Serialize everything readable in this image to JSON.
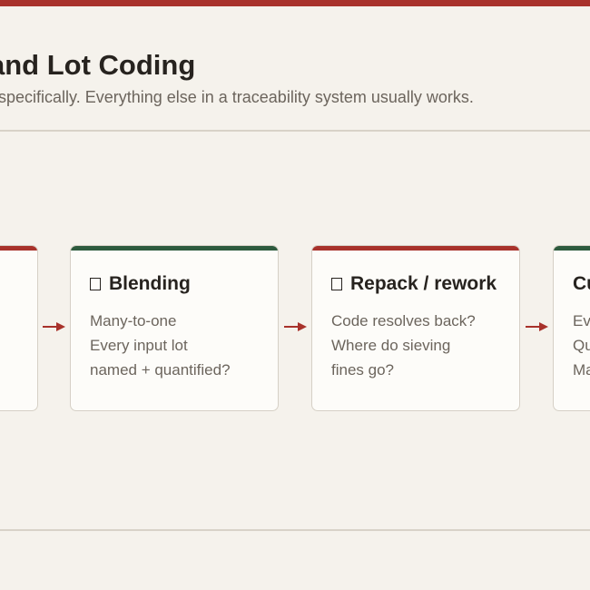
{
  "header": {
    "title": "and Lot Coding",
    "subtitle": "specifically. Everything else in a traceability system usually works."
  },
  "stages": [
    {
      "title": "",
      "lines": []
    },
    {
      "title": "Blending",
      "lines": [
        "Many-to-one",
        "Every input lot",
        "named + quantified?"
      ]
    },
    {
      "title": "Repack / rework",
      "lines": [
        "Code resolves back?",
        "Where do sieving",
        "fines go?"
      ]
    },
    {
      "title": "Cu",
      "lines": [
        "Ev",
        "Qu",
        "Ma"
      ]
    }
  ],
  "colors": {
    "red": "#a8322b",
    "green": "#2d5a3d",
    "background": "#f5f2ec"
  }
}
